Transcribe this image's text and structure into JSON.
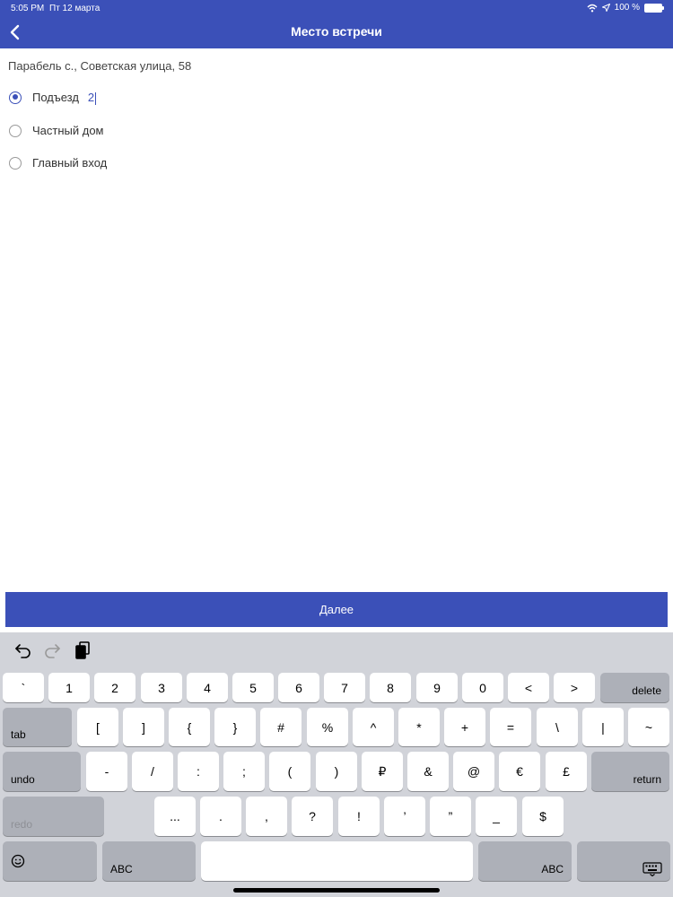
{
  "status_bar": {
    "time": "5:05 PM",
    "date": "Пт 12 марта",
    "battery": "100 %"
  },
  "nav": {
    "title": "Место встречи"
  },
  "address": "Парабель с., Советская улица, 58",
  "options": [
    {
      "label": "Подъезд",
      "value": "2",
      "selected": true
    },
    {
      "label": "Частный дом",
      "selected": false
    },
    {
      "label": "Главный вход",
      "selected": false
    }
  ],
  "next_button": "Далее",
  "keyboard": {
    "row1": [
      "`",
      "1",
      "2",
      "3",
      "4",
      "5",
      "6",
      "7",
      "8",
      "9",
      "0",
      "<",
      ">"
    ],
    "delete": "delete",
    "tab": "tab",
    "row2": [
      "[",
      "]",
      "{",
      "}",
      "#",
      "%",
      "^",
      "*",
      "+",
      "=",
      "\\",
      "|",
      "~"
    ],
    "undo": "undo",
    "row3": [
      "-",
      "/",
      ":",
      ";",
      "(",
      ")",
      "₽",
      "&",
      "@",
      "€",
      "£"
    ],
    "return": "return",
    "redo": "redo",
    "row4": [
      "...",
      ".",
      ",",
      "?",
      "!",
      "’",
      "”",
      "_",
      "$"
    ],
    "abc_left": "ABC",
    "abc_right": "ABC"
  },
  "colors": {
    "accent": "#3b50b8",
    "keyboard_bg": "#d1d3d9"
  }
}
